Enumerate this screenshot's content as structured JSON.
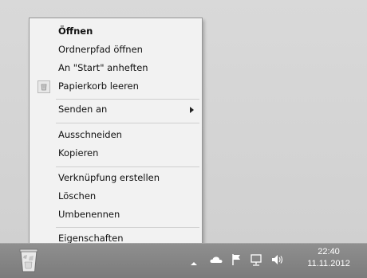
{
  "context_menu": {
    "items": [
      {
        "label": "Öffnen",
        "bold": true
      },
      {
        "label": "Ordnerpfad öffnen"
      },
      {
        "label": "An \"Start\" anheften"
      },
      {
        "label": "Papierkorb leeren",
        "icon": "recycle-bin-icon"
      },
      {
        "label": "Senden an",
        "submenu": true
      },
      {
        "label": "Ausschneiden"
      },
      {
        "label": "Kopieren"
      },
      {
        "label": "Verknüpfung erstellen"
      },
      {
        "label": "Löschen"
      },
      {
        "label": "Umbenennen"
      },
      {
        "label": "Eigenschaften"
      }
    ]
  },
  "taskbar": {
    "clock_time": "22:40",
    "clock_date": "11.11.2012",
    "tray_icons": [
      "show-hidden-icons-arrow",
      "cloud-icon",
      "action-center-flag-icon",
      "network-icon",
      "volume-icon"
    ]
  },
  "desktop": {
    "icon": "recycle-bin-icon"
  },
  "colors": {
    "menu_background": "#f2f2f2",
    "menu_border": "#979797",
    "taskbar": "#848484",
    "desktop": "#d6d6d6"
  }
}
